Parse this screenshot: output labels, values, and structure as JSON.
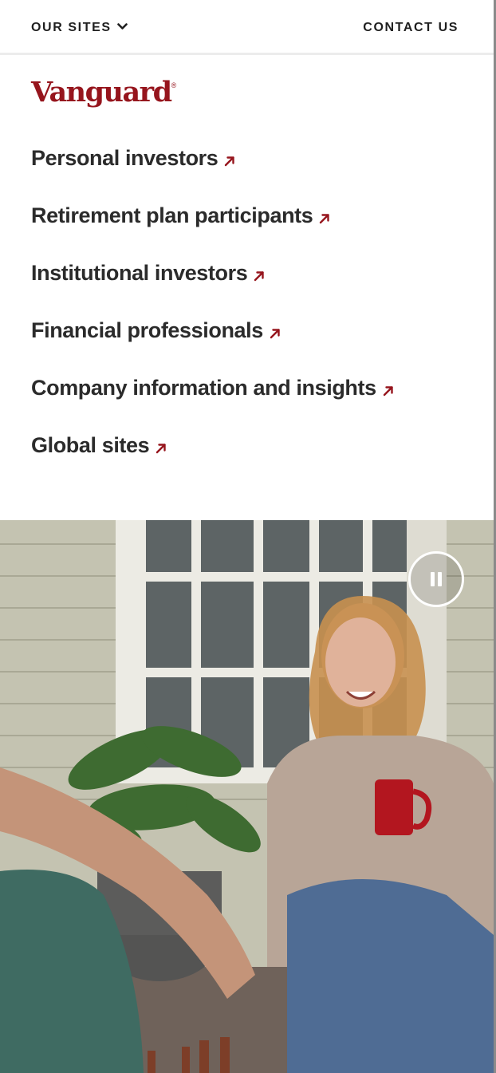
{
  "header": {
    "our_sites_label": "OUR SITES",
    "contact_label": "CONTACT US"
  },
  "brand": {
    "logo_text": "Vanguard",
    "logo_mark": "®",
    "color": "#96151d"
  },
  "site_links": [
    {
      "label": "Personal investors",
      "icon": "external-arrow-icon"
    },
    {
      "label": "Retirement plan participants",
      "icon": "external-arrow-icon"
    },
    {
      "label": "Institutional investors",
      "icon": "external-arrow-icon"
    },
    {
      "label": "Financial professionals",
      "icon": "external-arrow-icon"
    },
    {
      "label": "Company information and insights",
      "icon": "external-arrow-icon"
    },
    {
      "label": "Global sites",
      "icon": "external-arrow-icon"
    }
  ],
  "hero": {
    "media_control_icon": "pause-icon"
  },
  "colors": {
    "text": "#2b2b2b",
    "accent": "#96151d"
  }
}
